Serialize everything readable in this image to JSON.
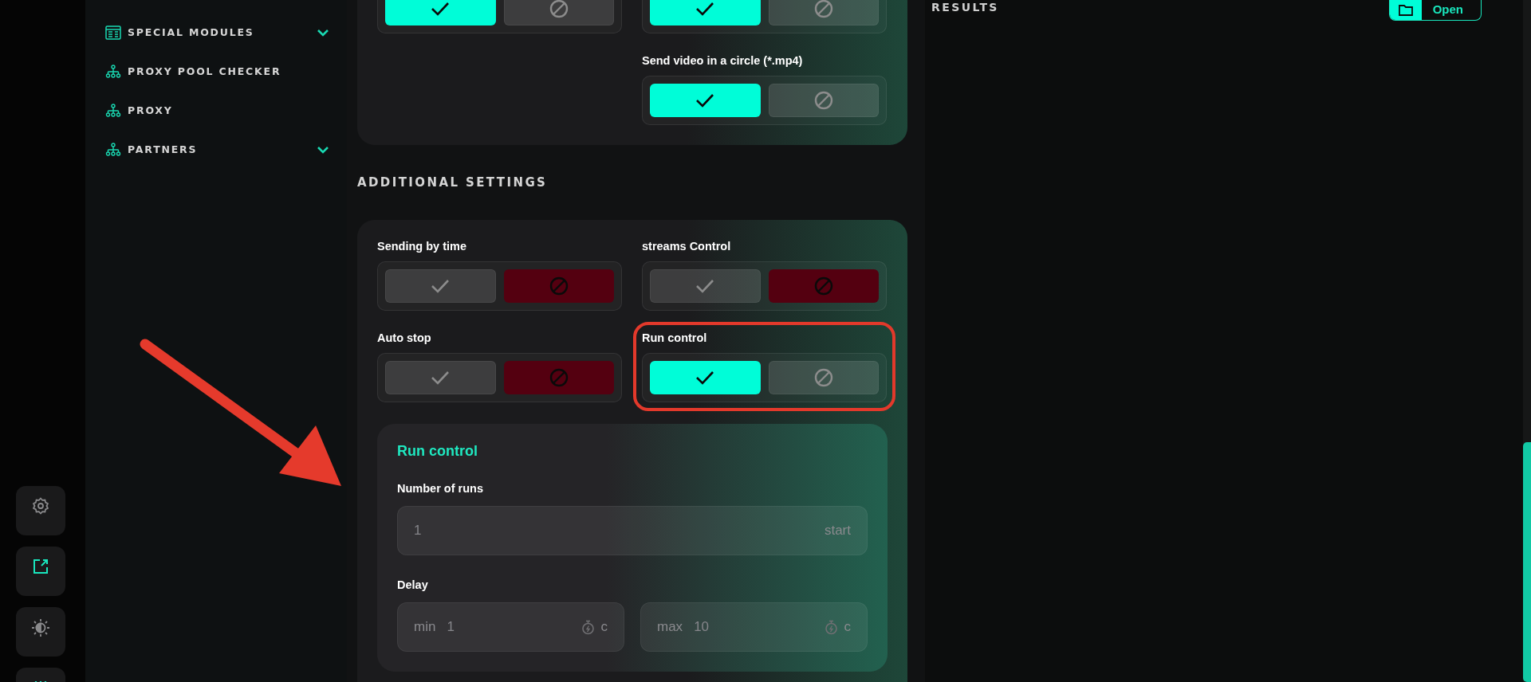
{
  "sidebar": {
    "items": [
      {
        "label": "SPECIAL MODULES",
        "expandable": true
      },
      {
        "label": "PROXY POOL CHECKER",
        "expandable": false
      },
      {
        "label": "PROXY",
        "expandable": false
      },
      {
        "label": "PARTNERS",
        "expandable": true
      }
    ]
  },
  "dock": [
    {
      "active": false
    },
    {
      "active": true
    },
    {
      "active": false
    },
    {
      "active": true
    }
  ],
  "top_card": {
    "toggles": [
      {
        "on": true
      },
      {
        "on": true
      },
      {
        "label": "Send video in a circle (*.mp4)",
        "on": true
      }
    ]
  },
  "additional": {
    "title": "ADDITIONAL SETTINGS",
    "toggles": [
      {
        "label": "Sending by time",
        "on": false,
        "highlighted": false
      },
      {
        "label": "streams Control",
        "on": false,
        "highlighted": false
      },
      {
        "label": "Auto stop",
        "on": false,
        "highlighted": false
      },
      {
        "label": "Run control",
        "on": true,
        "highlighted": true
      }
    ]
  },
  "run_control": {
    "title": "Run control",
    "runs": {
      "label": "Number of runs",
      "value": "1",
      "suffix": "start"
    },
    "delay": {
      "label": "Delay",
      "fields": [
        {
          "prefix": "min",
          "value": "1",
          "unit": "c"
        },
        {
          "prefix": "max",
          "value": "10",
          "unit": "c"
        }
      ]
    }
  },
  "results": {
    "title": "RESULTS",
    "open_button": "Open"
  }
}
